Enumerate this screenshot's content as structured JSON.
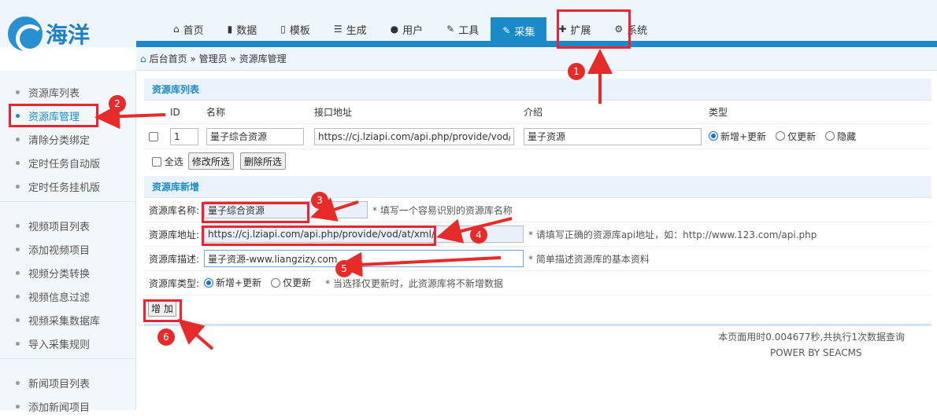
{
  "logo": {
    "text": "海洋"
  },
  "nav": [
    {
      "icon": "home-icon",
      "glyph": "⌂",
      "label": "首页"
    },
    {
      "icon": "book-icon",
      "glyph": "▮",
      "label": "数据"
    },
    {
      "icon": "file-icon",
      "glyph": "▯",
      "label": "模板"
    },
    {
      "icon": "server-icon",
      "glyph": "☰",
      "label": "生成"
    },
    {
      "icon": "user-icon",
      "glyph": "●",
      "label": "用户"
    },
    {
      "icon": "wrench-icon",
      "glyph": "✎",
      "label": "工具"
    },
    {
      "icon": "edit-icon",
      "glyph": "✎",
      "label": "采集"
    },
    {
      "icon": "puzzle-icon",
      "glyph": "✚",
      "label": "扩展"
    },
    {
      "icon": "gear-icon",
      "glyph": "⚙",
      "label": "系统"
    }
  ],
  "breadcrumb": {
    "text": "后台首页 » 管理员 » 资源库管理"
  },
  "sidebar": {
    "group1": [
      "资源库列表",
      "资源库管理",
      "清除分类绑定",
      "定时任务自动版",
      "定时任务挂机版"
    ],
    "group2": [
      "视频项目列表",
      "添加视频项目",
      "视频分类转换",
      "视频信息过滤",
      "视频采集数据库",
      "导入采集规则"
    ],
    "group3": [
      "新闻项目列表",
      "添加新闻项目"
    ]
  },
  "list_section": {
    "title": "资源库列表",
    "headers": {
      "id": "ID",
      "name": "名称",
      "api": "接口地址",
      "desc": "介绍",
      "type": "类型"
    },
    "row": {
      "id": "1",
      "name": "量子综合资源",
      "api": "https://cj.lziapi.com/api.php/provide/vod/at/",
      "desc": "量子资源",
      "type_options": [
        "新增+更新",
        "仅更新",
        "隐藏"
      ],
      "type_selected": "新增+更新"
    },
    "select_all": "全选",
    "modify_btn": "修改所选",
    "delete_btn": "删除所选"
  },
  "add_section": {
    "title": "资源库新增",
    "name_label": "资源库名称:",
    "name_value": "量子综合资源",
    "name_hint": "* 填写一个容易识别的资源库名称",
    "api_label": "资源库地址:",
    "api_value": "https://cj.lziapi.com/api.php/provide/vod/at/xml/",
    "api_hint": "* 请填写正确的资源库api地址，如：http://www.123.com/api.php",
    "desc_label": "资源库描述:",
    "desc_value": "量子资源-www.liangzizy.com",
    "desc_hint": "* 简单描述资源库的基本资料",
    "type_label": "资源库类型:",
    "type_options": [
      "新增+更新",
      "仅更新"
    ],
    "type_selected": "新增+更新",
    "type_hint": "* 当选择仅更新时，此资源库将不新增数据",
    "add_btn": "增 加"
  },
  "footer": {
    "stats": "本页面用时0.004677秒,共执行1次数据查询",
    "power": "POWER BY SEACMS"
  },
  "annotations": [
    "1",
    "2",
    "3",
    "4",
    "5",
    "6"
  ],
  "colors": {
    "accent": "#1b8ac8",
    "annotation": "#e62b2b"
  }
}
